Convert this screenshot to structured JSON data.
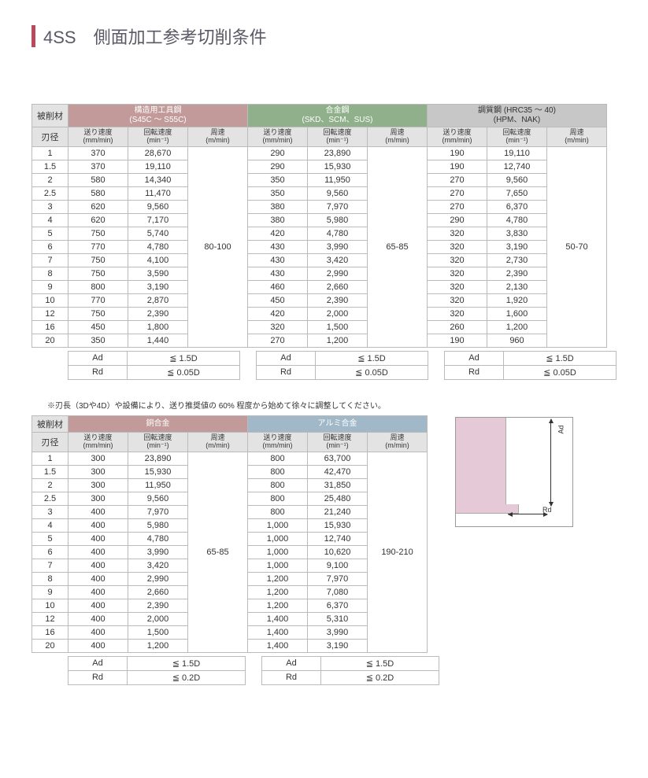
{
  "title": "4SS　側面加工参考切削条件",
  "labels": {
    "material": "被削材",
    "diameter": "刃径",
    "feed": "送り速度",
    "feed_unit": "(mm/min)",
    "rpm": "回転速度",
    "rpm_unit": "(min⁻¹)",
    "speed": "周速",
    "speed_unit": "(m/min)",
    "Ad": "Ad",
    "Rd": "Rd"
  },
  "groups1": [
    {
      "cls": "grp-red",
      "title": "構造用工具鋼",
      "sub": "(S45C ～ S55C)"
    },
    {
      "cls": "grp-grn",
      "title": "合金鋼",
      "sub": "(SKD、SCM、SUS)"
    },
    {
      "cls": "grp-gry",
      "title": "調質鋼 (HRC35 ～ 40)",
      "sub": "(HPM、NAK)"
    }
  ],
  "diameters": [
    "1",
    "1.5",
    "2",
    "2.5",
    "3",
    "4",
    "5",
    "6",
    "7",
    "8",
    "9",
    "10",
    "12",
    "16",
    "20"
  ],
  "tbl1": {
    "A": {
      "feed": [
        "370",
        "370",
        "580",
        "580",
        "620",
        "620",
        "750",
        "770",
        "750",
        "750",
        "800",
        "770",
        "750",
        "450",
        "350"
      ],
      "rpm": [
        "28,670",
        "19,110",
        "14,340",
        "11,470",
        "9,560",
        "7,170",
        "5,740",
        "4,780",
        "4,100",
        "3,590",
        "3,190",
        "2,870",
        "2,390",
        "1,800",
        "1,440"
      ],
      "speed": "80-100"
    },
    "B": {
      "feed": [
        "290",
        "290",
        "350",
        "350",
        "380",
        "380",
        "420",
        "430",
        "430",
        "430",
        "460",
        "450",
        "420",
        "320",
        "270"
      ],
      "rpm": [
        "23,890",
        "15,930",
        "11,950",
        "9,560",
        "7,970",
        "5,980",
        "4,780",
        "3,990",
        "3,420",
        "2,990",
        "2,660",
        "2,390",
        "2,000",
        "1,500",
        "1,200"
      ],
      "speed": "65-85"
    },
    "C": {
      "feed": [
        "190",
        "190",
        "270",
        "270",
        "270",
        "290",
        "320",
        "320",
        "320",
        "320",
        "320",
        "320",
        "320",
        "260",
        "190"
      ],
      "rpm": [
        "19,110",
        "12,740",
        "9,560",
        "7,650",
        "6,370",
        "4,780",
        "3,830",
        "3,190",
        "2,730",
        "2,390",
        "2,130",
        "1,920",
        "1,600",
        "1,200",
        "960"
      ],
      "speed": "50-70"
    }
  },
  "limits1": {
    "Ad": "≦ 1.5D",
    "Rd": "≦ 0.05D"
  },
  "note": "※刃長（3Dや4D）や設備により、送り推奨値の 60% 程度から始めて徐々に調整してください。",
  "groups2": [
    {
      "cls": "grp-brn",
      "title": "銅合金"
    },
    {
      "cls": "grp-blu",
      "title": "アルミ合金"
    }
  ],
  "tbl2": {
    "A": {
      "feed": [
        "300",
        "300",
        "300",
        "300",
        "400",
        "400",
        "400",
        "400",
        "400",
        "400",
        "400",
        "400",
        "400",
        "400",
        "400"
      ],
      "rpm": [
        "23,890",
        "15,930",
        "11,950",
        "9,560",
        "7,970",
        "5,980",
        "4,780",
        "3,990",
        "3,420",
        "2,990",
        "2,660",
        "2,390",
        "2,000",
        "1,500",
        "1,200"
      ],
      "speed": "65-85"
    },
    "B": {
      "feed": [
        "800",
        "800",
        "800",
        "800",
        "800",
        "1,000",
        "1,000",
        "1,000",
        "1,000",
        "1,200",
        "1,200",
        "1,200",
        "1,400",
        "1,400",
        "1,400"
      ],
      "rpm": [
        "63,700",
        "42,470",
        "31,850",
        "25,480",
        "21,240",
        "15,930",
        "12,740",
        "10,620",
        "9,100",
        "7,970",
        "7,080",
        "6,370",
        "5,310",
        "3,990",
        "3,190"
      ],
      "speed": "190-210"
    }
  },
  "limits2": {
    "Ad": "≦ 1.5D",
    "Rd": "≦ 0.2D"
  },
  "chart_data": [
    {
      "type": "table",
      "title": "側面加工参考切削条件（構造用工具鋼 / 合金鋼 / 調質鋼）",
      "x": [
        "1",
        "1.5",
        "2",
        "2.5",
        "3",
        "4",
        "5",
        "6",
        "7",
        "8",
        "9",
        "10",
        "12",
        "16",
        "20"
      ],
      "series": [
        {
          "name": "構造用工具鋼 送り速度 (mm/min)",
          "values": [
            370,
            370,
            580,
            580,
            620,
            620,
            750,
            770,
            750,
            750,
            800,
            770,
            750,
            450,
            350
          ]
        },
        {
          "name": "構造用工具鋼 回転速度 (min⁻¹)",
          "values": [
            28670,
            19110,
            14340,
            11470,
            9560,
            7170,
            5740,
            4780,
            4100,
            3590,
            3190,
            2870,
            2390,
            1800,
            1440
          ]
        },
        {
          "name": "合金鋼 送り速度 (mm/min)",
          "values": [
            290,
            290,
            350,
            350,
            380,
            380,
            420,
            430,
            430,
            430,
            460,
            450,
            420,
            320,
            270
          ]
        },
        {
          "name": "合金鋼 回転速度 (min⁻¹)",
          "values": [
            23890,
            15930,
            11950,
            9560,
            7970,
            5980,
            4780,
            3990,
            3420,
            2990,
            2660,
            2390,
            2000,
            1500,
            1200
          ]
        },
        {
          "name": "調質鋼 送り速度 (mm/min)",
          "values": [
            190,
            190,
            270,
            270,
            270,
            290,
            320,
            320,
            320,
            320,
            320,
            320,
            320,
            260,
            190
          ]
        },
        {
          "name": "調質鋼 回転速度 (min⁻¹)",
          "values": [
            19110,
            12740,
            9560,
            7650,
            6370,
            4780,
            3830,
            3190,
            2730,
            2390,
            2130,
            1920,
            1600,
            1200,
            960
          ]
        }
      ],
      "notes": {
        "構造用工具鋼 周速 (m/min)": "80-100",
        "合金鋼 周速 (m/min)": "65-85",
        "調質鋼 周速 (m/min)": "50-70"
      }
    },
    {
      "type": "table",
      "title": "側面加工参考切削条件（銅合金 / アルミ合金）",
      "x": [
        "1",
        "1.5",
        "2",
        "2.5",
        "3",
        "4",
        "5",
        "6",
        "7",
        "8",
        "9",
        "10",
        "12",
        "16",
        "20"
      ],
      "series": [
        {
          "name": "銅合金 送り速度 (mm/min)",
          "values": [
            300,
            300,
            300,
            300,
            400,
            400,
            400,
            400,
            400,
            400,
            400,
            400,
            400,
            400,
            400
          ]
        },
        {
          "name": "銅合金 回転速度 (min⁻¹)",
          "values": [
            23890,
            15930,
            11950,
            9560,
            7970,
            5980,
            4780,
            3990,
            3420,
            2990,
            2660,
            2390,
            2000,
            1500,
            1200
          ]
        },
        {
          "name": "アルミ合金 送り速度 (mm/min)",
          "values": [
            800,
            800,
            800,
            800,
            800,
            1000,
            1000,
            1000,
            1000,
            1200,
            1200,
            1200,
            1400,
            1400,
            1400
          ]
        },
        {
          "name": "アルミ合金 回転速度 (min⁻¹)",
          "values": [
            63700,
            42470,
            31850,
            25480,
            21240,
            15930,
            12740,
            10620,
            9100,
            7970,
            7080,
            6370,
            5310,
            3990,
            3190
          ]
        }
      ],
      "notes": {
        "銅合金 周速 (m/min)": "65-85",
        "アルミ合金 周速 (m/min)": "190-210"
      }
    }
  ]
}
